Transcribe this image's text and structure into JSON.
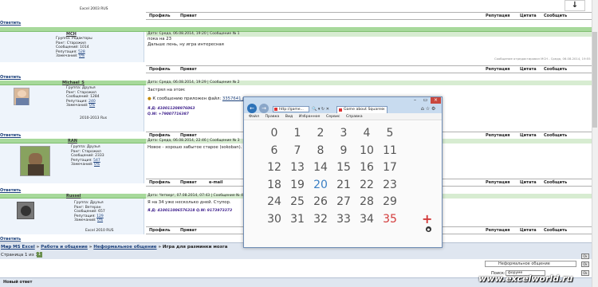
{
  "forum": {
    "top_signature": "Excel 2003 RUS",
    "toolbar": {
      "profile": "Профиль",
      "private": "Приват",
      "email": "e-mail",
      "reputation": "Репутация",
      "quote": "Цитата",
      "message": "Сообщить"
    },
    "reply_link": "Ответить",
    "posts": [
      {
        "username": "МСН",
        "group": "Группа: Редакторы",
        "rank": "Ранг: Старожил",
        "msg_count": "Сообщений: 1014",
        "reputation": "Репутация:",
        "rep_value": "528",
        "remarks": "Замечаний:",
        "rem_value": "0%",
        "date": "Дата: Среда, 06.08.2014, 19:20 | Сообщение № 1",
        "lines": [
          "пока на 23",
          "Дальше лень, ну игра интересная"
        ],
        "edited": "Сообщение отредактировал МСН - Среда, 06.08.2014, 19:55"
      },
      {
        "username": "Michael_S",
        "group": "Группа: Друзья",
        "rank": "Ранг: Старожил",
        "msg_count": "Сообщений: 1284",
        "reputation": "Репутация:",
        "rep_value": "240",
        "remarks": "Замечаний:",
        "rem_value": "0%",
        "signature": "2010-2013 Rus",
        "date": "Дата: Среда, 06.08.2014, 19:29 | Сообщение № 2",
        "lines": [
          "Застрял на этом:"
        ],
        "attachment_label": "К сообщению приложен файл:",
        "attachment_file": "3357641.png",
        "wallet1": "Я.Д: 410011208976063",
        "wallet2": "Q.W: +79007716387"
      },
      {
        "username": "RAN",
        "group": "Группа: Друзья",
        "rank": "Ранг: Старожил",
        "msg_count": "Сообщений: 2333",
        "reputation": "Репутация:",
        "rep_value": "547",
        "remarks": "Замечаний:",
        "rem_value": "0%",
        "date": "Дата: Среда, 06.08.2014, 22:46 | Сообщение № 3",
        "lines": [
          "Новое - хорошо забытое старое (sokoban)."
        ]
      },
      {
        "username": "Russel",
        "group": "Группа: Друзья",
        "rank": "Ранг: Ветеран",
        "msg_count": "Сообщений: 657",
        "reputation": "Репутация:",
        "rep_value": "129",
        "remarks": "Замечаний:",
        "rem_value": "0%",
        "signature": "Excel 2010 RUS",
        "date": "Дата: Четверг, 07.08.2014, 07:43 | Сообщение № 4",
        "lines": [
          "Я на 34 уже несколько дней. Ступор."
        ],
        "wallet1": "Я.Д: 410011006576318 Q.W: 9173973373"
      }
    ],
    "breadcrumb": [
      "Мир MS Excel",
      "Работа и общение",
      "Неформальное общение",
      "Игра для разминки мозга"
    ],
    "pages_label": "Страница 1 из 1",
    "page_num": "1",
    "forum_select": "Неформальное общение",
    "search_label": "Поиск:",
    "search_value": "форуме",
    "ok_label": "Ok",
    "quick_reply": "Новый ответ",
    "watermark": "www.excelworld.ru",
    "download_arrow": "↓"
  },
  "popup": {
    "url": "http://game...",
    "tab_title": "Game about Squares",
    "menu": [
      "Файл",
      "Правка",
      "Вид",
      "Избранное",
      "Сервис",
      "Справка"
    ],
    "numbers": [
      [
        "0",
        "1",
        "2",
        "3",
        "4",
        "5"
      ],
      [
        "6",
        "7",
        "8",
        "9",
        "10",
        "11"
      ],
      [
        "12",
        "13",
        "14",
        "15",
        "16",
        "17"
      ],
      [
        "18",
        "19",
        "20",
        "21",
        "22",
        "23"
      ],
      [
        "24",
        "25",
        "26",
        "27",
        "28",
        "29"
      ],
      [
        "30",
        "31",
        "32",
        "33",
        "34",
        "35"
      ]
    ],
    "highlight_blue": "20",
    "highlight_red": "35",
    "plus_icon": "+",
    "colors": {
      "blue": "#3a7fc4",
      "red": "#d33a3a",
      "text": "#555555"
    }
  }
}
